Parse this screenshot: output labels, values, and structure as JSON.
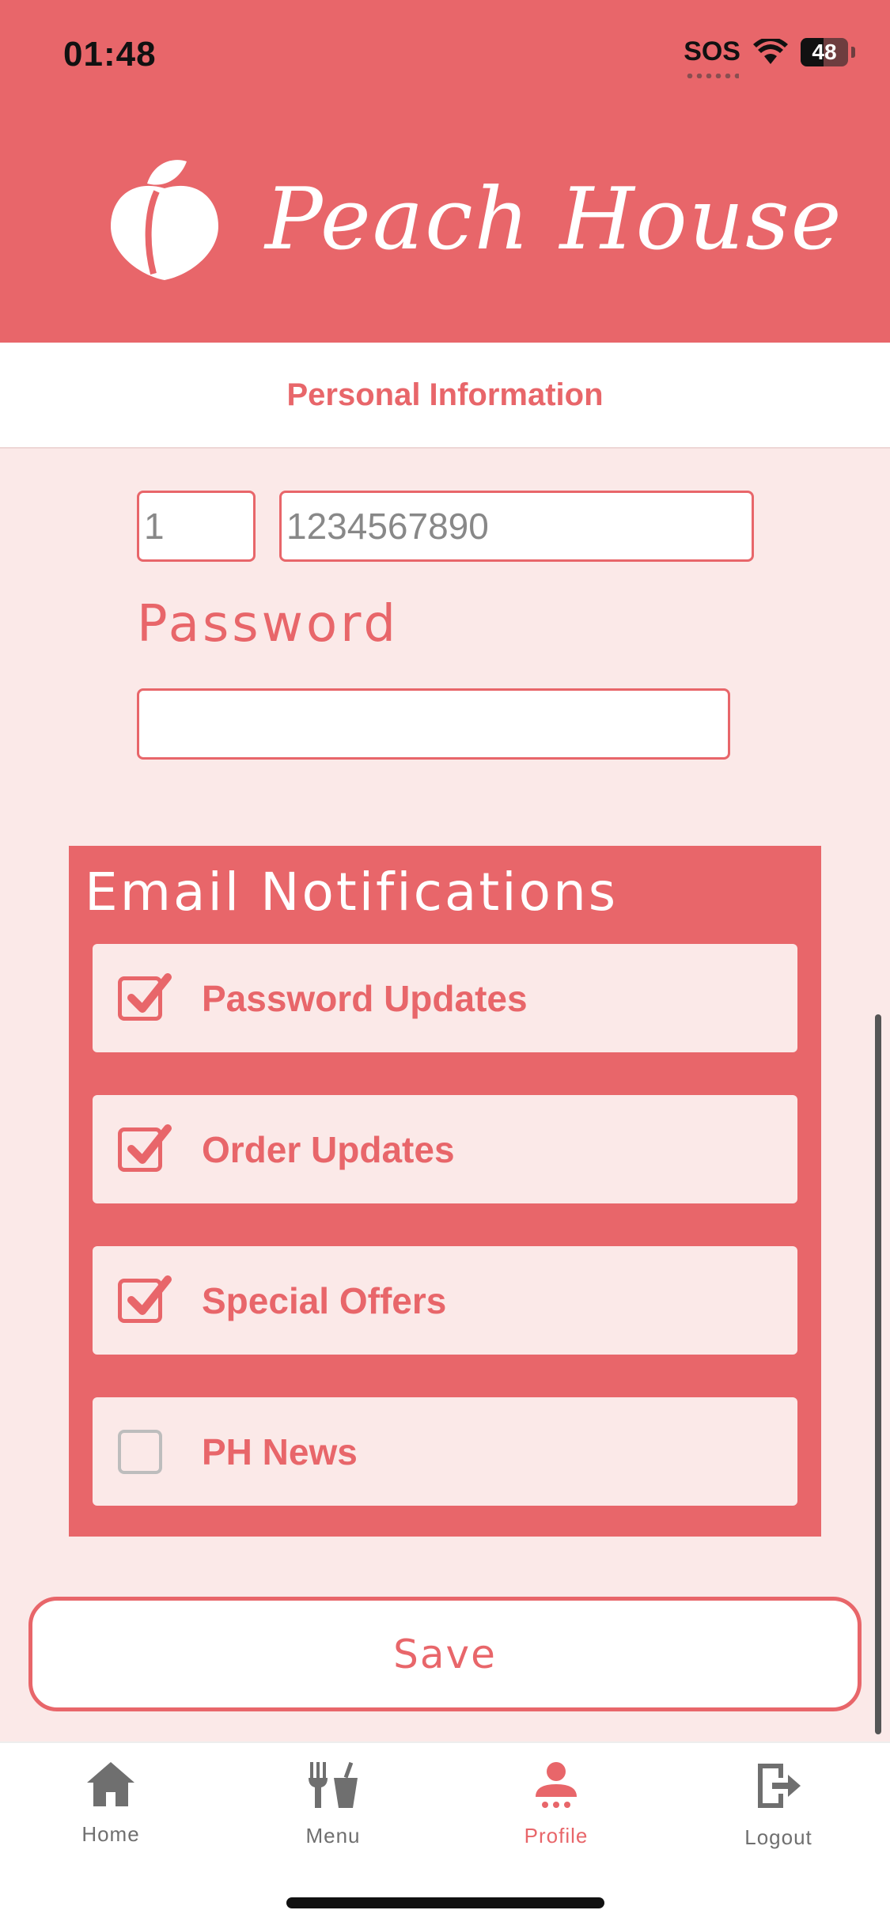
{
  "status_bar": {
    "time": "01:48",
    "carrier": "SOS",
    "battery": "48"
  },
  "header": {
    "brand": "Peach House"
  },
  "section": {
    "title": "Personal Information"
  },
  "form": {
    "country_code_placeholder": "1",
    "phone_placeholder": "1234567890",
    "password_label": "Password",
    "password_value": ""
  },
  "notifications": {
    "title": "Email Notifications",
    "items": [
      {
        "label": "Password Updates",
        "checked": true
      },
      {
        "label": "Order Updates",
        "checked": true
      },
      {
        "label": "Special Offers",
        "checked": true
      },
      {
        "label": "PH News",
        "checked": false
      }
    ]
  },
  "actions": {
    "save_label": "Save"
  },
  "tabbar": {
    "items": [
      {
        "label": "Home",
        "icon": "home-icon"
      },
      {
        "label": "Menu",
        "icon": "utensils-icon"
      },
      {
        "label": "Profile",
        "icon": "user-icon"
      },
      {
        "label": "Logout",
        "icon": "logout-icon"
      }
    ],
    "active": "Profile"
  },
  "colors": {
    "accent": "#E8666A",
    "background": "#FBE9E8",
    "inactive": "#6F6F6F"
  }
}
